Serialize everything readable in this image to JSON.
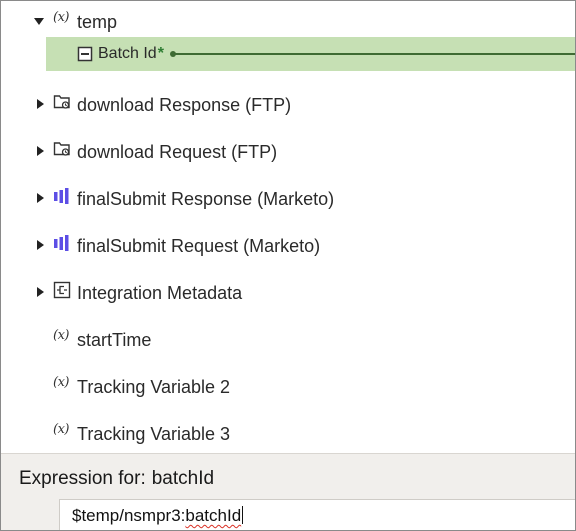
{
  "tree": {
    "items": [
      {
        "label": "temp",
        "icon": "variable-icon",
        "expanded": true
      },
      {
        "label": "Batch Id",
        "icon": "string-field-icon",
        "selected": true,
        "required_mark": "*",
        "mapped": true
      },
      {
        "label": "download Response (FTP)",
        "icon": "ftp-folder-icon",
        "expanded": false
      },
      {
        "label": "download Request (FTP)",
        "icon": "ftp-folder-icon",
        "expanded": false
      },
      {
        "label": "finalSubmit Response (Marketo)",
        "icon": "marketo-icon",
        "expanded": false
      },
      {
        "label": "finalSubmit Request (Marketo)",
        "icon": "marketo-icon",
        "expanded": false
      },
      {
        "label": "Integration Metadata",
        "icon": "metadata-icon",
        "expanded": false
      },
      {
        "label": "startTime",
        "icon": "variable-icon"
      },
      {
        "label": "Tracking Variable 2",
        "icon": "variable-icon"
      },
      {
        "label": "Tracking Variable 3",
        "icon": "variable-icon"
      }
    ],
    "variable_glyph": "(x)"
  },
  "expression": {
    "title": "Expression for:",
    "field_name": "batchId",
    "prefix": "$temp/nsmpr3:",
    "suffix": "batchId"
  },
  "colors": {
    "selected_background": "#c6e0b4",
    "mapping_line": "#3e6b33",
    "required_mark": "#2e7d32",
    "marketo_icon": "#5c4ee5",
    "panel_background": "#f1efec"
  }
}
